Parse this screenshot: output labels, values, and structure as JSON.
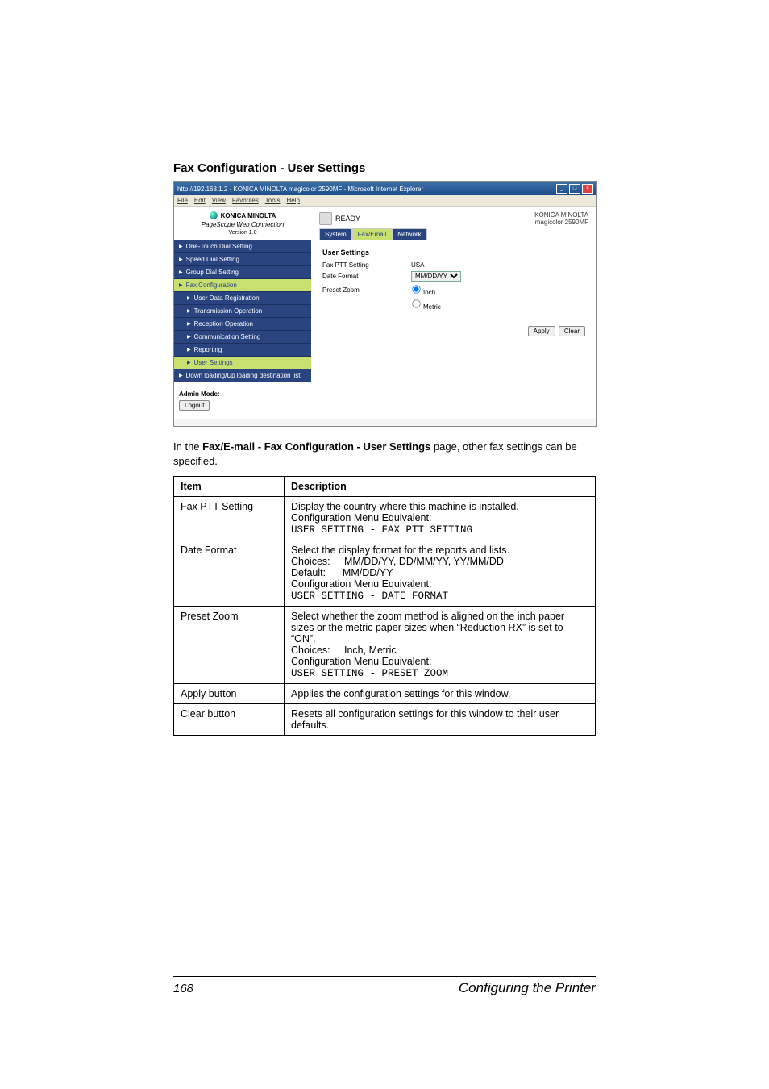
{
  "section_title": "Fax Configuration - User Settings",
  "screenshot": {
    "window_title": "http://192.168.1.2 - KONICA MINOLTA magicolor 2590MF - Microsoft Internet Explorer",
    "menubar": [
      "File",
      "Edit",
      "View",
      "Favorites",
      "Tools",
      "Help"
    ],
    "brand": {
      "name": "KONICA MINOLTA",
      "product": "PageScope Web Connection",
      "version": "Version 1.0"
    },
    "nav": {
      "items": [
        {
          "label": "One-Touch Dial Setting",
          "sub": false,
          "sel": false
        },
        {
          "label": "Speed Dial Setting",
          "sub": false,
          "sel": false
        },
        {
          "label": "Group Dial Setting",
          "sub": false,
          "sel": false
        },
        {
          "label": "Fax Configuration",
          "sub": false,
          "sel": true
        },
        {
          "label": "User Data Registration",
          "sub": true,
          "sel": false
        },
        {
          "label": "Transmission Operation",
          "sub": true,
          "sel": false
        },
        {
          "label": "Reception Operation",
          "sub": true,
          "sel": false
        },
        {
          "label": "Communication Setting",
          "sub": true,
          "sel": false
        },
        {
          "label": "Reporting",
          "sub": true,
          "sel": false
        },
        {
          "label": "User Settings",
          "sub": true,
          "sel": true
        },
        {
          "label": "Down loading/Up loading destination list",
          "sub": false,
          "sel": false
        }
      ]
    },
    "admin_mode": {
      "label": "Admin Mode:",
      "button": "Logout"
    },
    "status": "READY",
    "product_lines": {
      "l1": "KONICA MINOLTA",
      "l2": "magicolor 2590MF"
    },
    "tabs": [
      {
        "label": "System",
        "active": false
      },
      {
        "label": "Fax/Email",
        "active": true
      },
      {
        "label": "Network",
        "active": false
      }
    ],
    "content": {
      "heading": "User Settings",
      "rows": [
        {
          "label": "Fax PTT Setting",
          "value": "USA",
          "type": "text"
        },
        {
          "label": "Date Format",
          "value": "MM/DD/YY",
          "type": "select"
        },
        {
          "label": "Preset Zoom",
          "value": "radio",
          "options": [
            "Inch",
            "Metric"
          ],
          "selected": "Inch"
        }
      ],
      "buttons": {
        "apply": "Apply",
        "clear": "Clear"
      }
    }
  },
  "intro": "In the Fax/E-mail - Fax Configuration - User Settings page, other fax settings can be specified.",
  "intro_bold": "Fax/E-mail - Fax Configuration - User Settings",
  "table": {
    "head": {
      "c1": "Item",
      "c2": "Description"
    },
    "rows": [
      {
        "item": "Fax PTT Setting",
        "desc": "Display the country where this machine is installed.\nConfiguration Menu Equivalent:",
        "code": "USER SETTING - FAX PTT SETTING"
      },
      {
        "item": "Date Format",
        "desc": "Select the display format for the reports and lists.\nChoices:     MM/DD/YY, DD/MM/YY, YY/MM/DD\nDefault:      MM/DD/YY\nConfiguration Menu Equivalent:",
        "code": "USER SETTING - DATE FORMAT"
      },
      {
        "item": "Preset Zoom",
        "desc": "Select whether the zoom method is aligned on the inch paper sizes or the metric paper sizes when “Reduction RX” is set to “ON”.\nChoices:     Inch, Metric\nConfiguration Menu Equivalent:",
        "code": "USER SETTING - PRESET ZOOM"
      },
      {
        "item": "Apply button",
        "desc": "Applies the configuration settings for this window.",
        "code": ""
      },
      {
        "item": "Clear button",
        "desc": "Resets all configuration settings for this window to their user defaults.",
        "code": ""
      }
    ]
  },
  "footer": {
    "page": "168",
    "title": "Configuring the Printer"
  }
}
